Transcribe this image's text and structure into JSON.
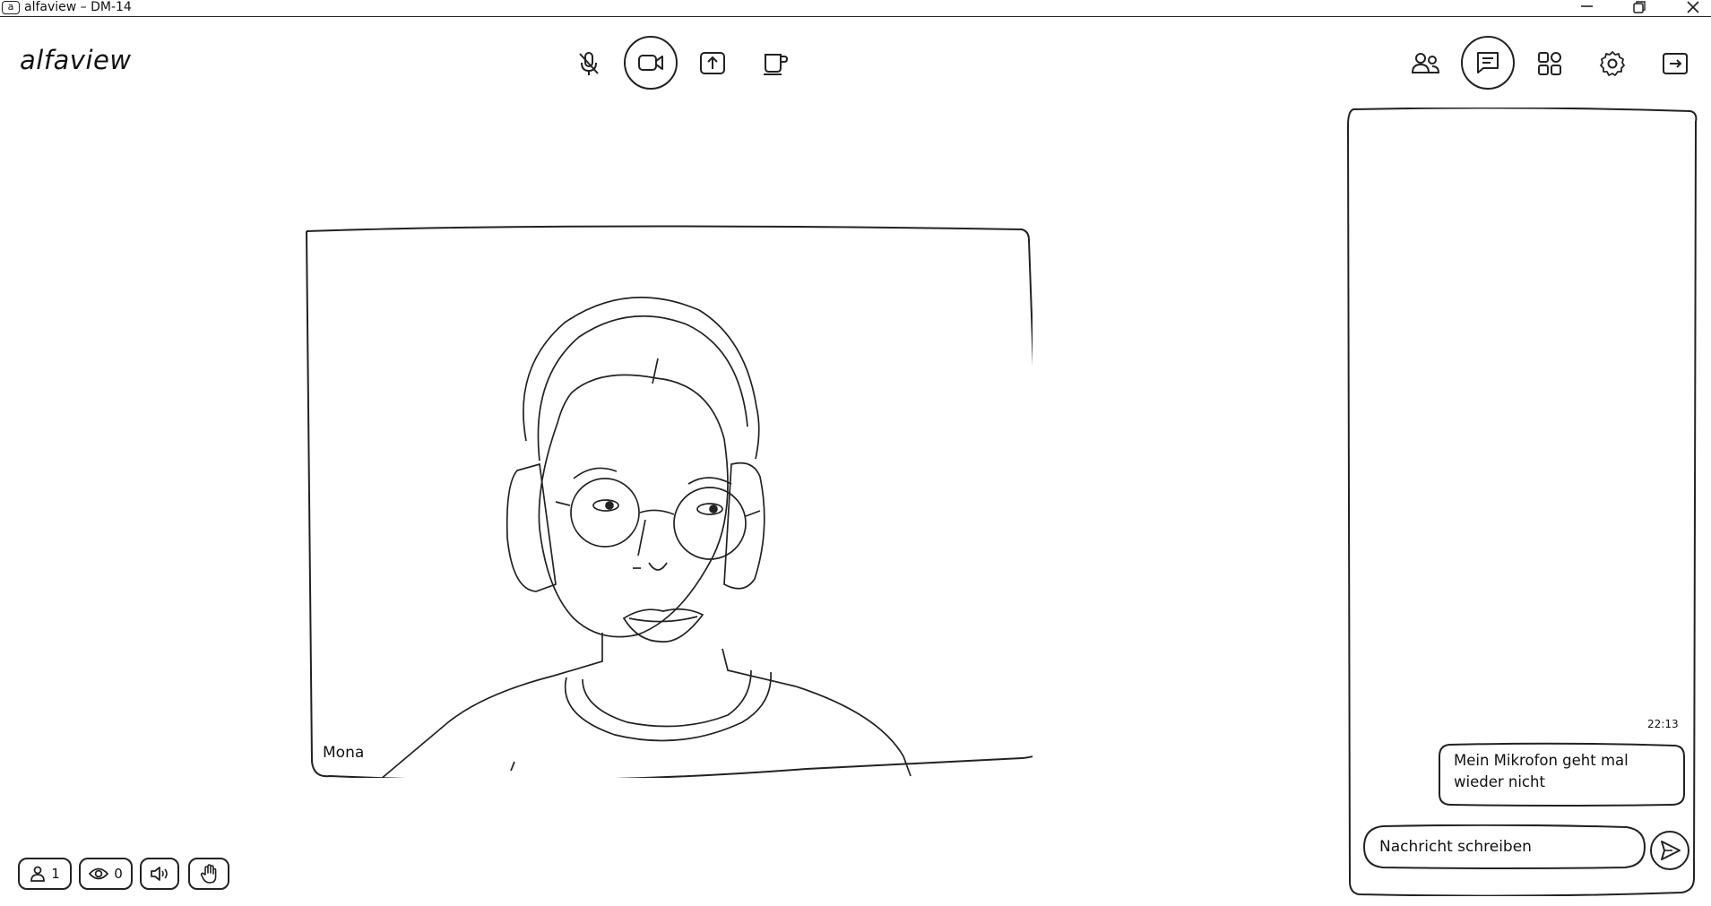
{
  "window": {
    "title": "alfaview – DM-14",
    "logo_letter": "a"
  },
  "header": {
    "brand": "alfaview",
    "controls": [
      {
        "name": "microphone-muted",
        "active": false
      },
      {
        "name": "camera",
        "active": true
      },
      {
        "name": "share-screen",
        "active": false
      },
      {
        "name": "break",
        "active": false
      }
    ],
    "right_controls": [
      {
        "name": "participants",
        "active": false
      },
      {
        "name": "chat",
        "active": true
      },
      {
        "name": "apps",
        "active": false
      },
      {
        "name": "settings",
        "active": false
      },
      {
        "name": "leave",
        "active": false
      }
    ]
  },
  "video": {
    "participant_name": "Mona"
  },
  "chat": {
    "messages": [
      {
        "time": "22:13",
        "text": "Mein Mikrofon geht mal wieder nicht"
      }
    ],
    "input_placeholder": "Nachricht schreiben"
  },
  "footer": {
    "participants_count": "1",
    "viewers_count": "0"
  }
}
